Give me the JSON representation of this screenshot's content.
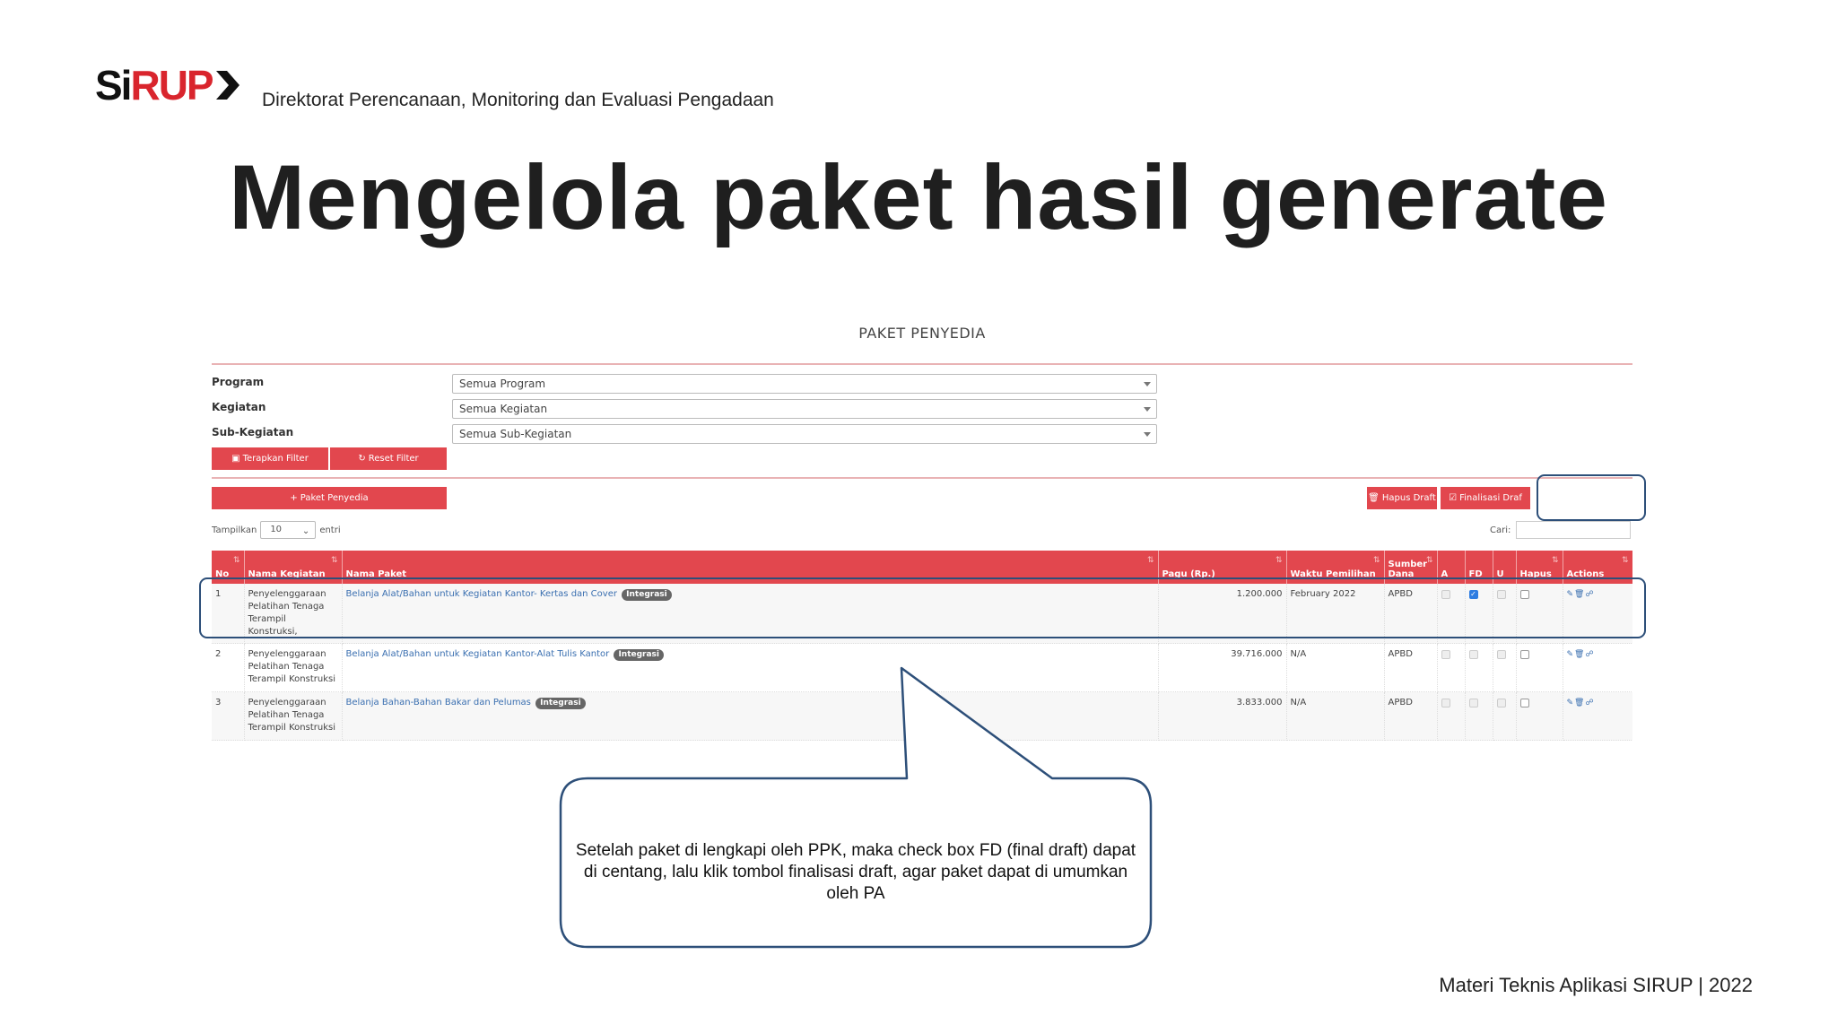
{
  "slide": {
    "logo_si": "Si",
    "logo_rup": "RUP",
    "org": "Direktorat Perencanaan, Monitoring dan Evaluasi Pengadaan",
    "title": "Mengelola paket hasil generate",
    "footer": "Materi Teknis Aplikasi SIRUP | 2022",
    "callout": "Setelah paket di lengkapi oleh PPK, maka check box FD (final draft) dapat di centang, lalu klik tombol finalisasi draft, agar paket dapat di umumkan oleh PA",
    "highlight_color": "#2d4f79"
  },
  "app": {
    "title": "PAKET PENYEDIA",
    "accent": "#e2474e",
    "filters": [
      {
        "label": "Program",
        "value": "Semua Program"
      },
      {
        "label": "Kegiatan",
        "value": "Semua Kegiatan"
      },
      {
        "label": "Sub-Kegiatan",
        "value": "Semua Sub-Kegiatan"
      }
    ],
    "apply_filter": "Terapkan Filter",
    "reset_filter": "Reset Filter",
    "add_button": "Paket Penyedia",
    "delete_draft": "Hapus Draft",
    "finalize_draft": "Finalisasi Draf",
    "length_label_pre": "Tampilkan",
    "length_value": "10",
    "length_label_post": "entri",
    "search_label": "Cari:",
    "columns": [
      "No",
      "Nama Kegiatan",
      "Nama Paket",
      "Pagu (Rp.)",
      "Waktu Pemilihan",
      "Sumber Dana",
      "A",
      "FD",
      "U",
      "Hapus",
      "Actions"
    ],
    "tag_label": "Integrasi",
    "rows": [
      {
        "no": "1",
        "kegiatan": "Penyelenggaraan Pelatihan Tenaga Terampil Konstruksi,",
        "paket": "Belanja Alat/Bahan untuk Kegiatan Kantor- Kertas dan Cover",
        "pagu": "1.200.000",
        "waktu": "February 2022",
        "sumber": "APBD"
      },
      {
        "no": "2",
        "kegiatan": "Penyelenggaraan Pelatihan Tenaga Terampil Konstruksi",
        "paket": "Belanja Alat/Bahan untuk Kegiatan Kantor-Alat Tulis Kantor",
        "pagu": "39.716.000",
        "waktu": "N/A",
        "sumber": "APBD"
      },
      {
        "no": "3",
        "kegiatan": "Penyelenggaraan Pelatihan Tenaga Terampil Konstruksi",
        "paket": "Belanja Bahan-Bahan Bakar dan Pelumas",
        "pagu": "3.833.000",
        "waktu": "N/A",
        "sumber": "APBD"
      }
    ]
  }
}
